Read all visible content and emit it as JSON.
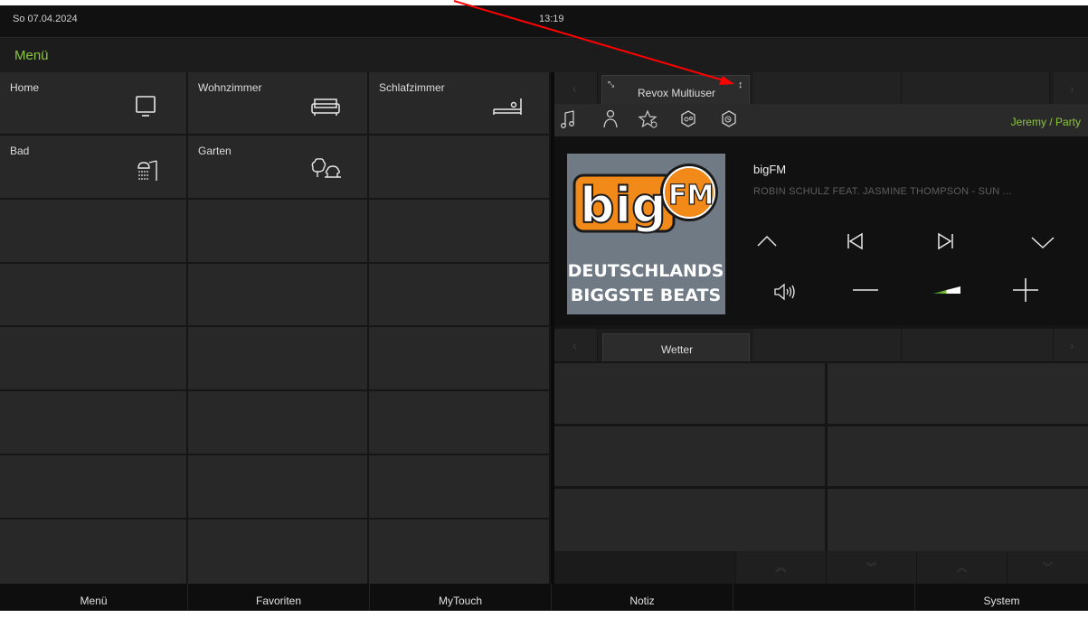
{
  "status": {
    "date": "So  07.04.2024",
    "time": "13:19"
  },
  "menu": {
    "title": "Menü"
  },
  "rooms": [
    {
      "label": "Home",
      "icon": "tv-icon"
    },
    {
      "label": "Wohnzimmer",
      "icon": "sofa-icon"
    },
    {
      "label": "Schlafzimmer",
      "icon": "bed-icon"
    },
    {
      "label": "Bad",
      "icon": "shower-icon"
    },
    {
      "label": "Garten",
      "icon": "trees-icon"
    }
  ],
  "player": {
    "tab_label": "Revox Multiuser",
    "user_label": "Jeremy / Party",
    "station": "bigFM",
    "track": "ROBIN SCHULZ FEAT. JASMINE THOMPSON - SUN ...",
    "source_icons": [
      "music-note-icon",
      "person-icon",
      "star-icon",
      "source-icon",
      "source-alt-icon"
    ],
    "album_art": {
      "logo_text_1": "big",
      "logo_text_2": "FM",
      "line1": "DEUTSCHLANDS",
      "line2": "BIGGSTE BEATS"
    },
    "volume_level": 0.5
  },
  "weather": {
    "tab_label": "Wetter"
  },
  "footer": {
    "items": [
      "Menü",
      "Favoriten",
      "MyTouch",
      "Notiz",
      "",
      "System"
    ]
  },
  "colors": {
    "accent": "#8cc63f",
    "tile": "#282828",
    "background": "#151515",
    "annotation_arrow": "#ff0000"
  }
}
